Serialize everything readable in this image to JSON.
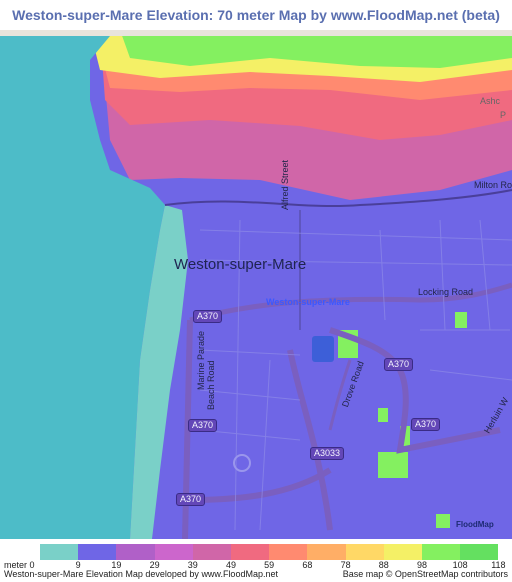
{
  "title": "Weston-super-Mare Elevation: 70 meter Map by www.FloodMap.net (beta)",
  "map": {
    "place_name": "Weston-super-Mare",
    "road_labels": {
      "alfred_street": "Alfred Street",
      "locking_road": "Locking Road",
      "milton_road": "Milton Ro",
      "marine_parade": "Marine Parade",
      "beach_road": "Beach Road",
      "drove_road": "Drove Road",
      "herluin_way": "Herluin W",
      "ashcombe": "Ashc",
      "ashcombe_p": "P",
      "station_label": "Weston-super-Mare"
    },
    "shields": {
      "a370_north": "A370",
      "a370_east": "A370",
      "a370_mid": "A370",
      "a370_southeast": "A370",
      "a370_south": "A370",
      "a3033": "A3033"
    },
    "logo_text": "FloodMap"
  },
  "legend": {
    "unit": "meter 0",
    "ticks": [
      "9",
      "19",
      "29",
      "39",
      "49",
      "59",
      "68",
      "78",
      "88",
      "98",
      "108",
      "118"
    ],
    "colors": [
      "#7ad0c8",
      "#6f66e6",
      "#b060c8",
      "#cc66cc",
      "#d066a8",
      "#f06a80",
      "#ff8a70",
      "#ffae66",
      "#ffd866",
      "#f4f066",
      "#84f060",
      "#64e060"
    ]
  },
  "footer": {
    "left": "Weston-super-Mare Elevation Map developed by www.FloodMap.net",
    "right": "Base map © OpenStreetMap contributors"
  }
}
